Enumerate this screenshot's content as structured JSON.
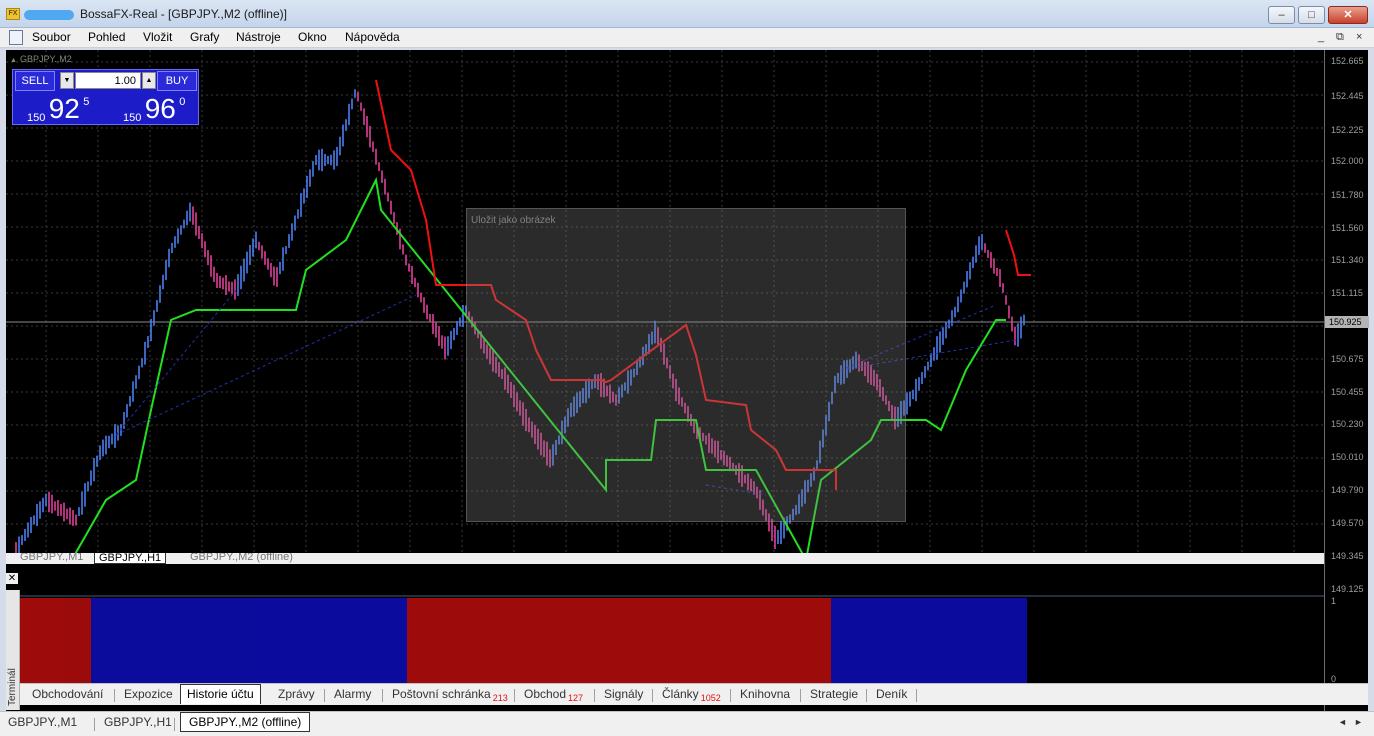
{
  "window": {
    "title": "BossaFX-Real - [GBPJPY.,M2 (offline)]",
    "minimize": "–",
    "maximize": "□",
    "close": "✕"
  },
  "menu": [
    "Soubor",
    "Pohled",
    "Vložit",
    "Grafy",
    "Nástroje",
    "Okno",
    "Nápověda"
  ],
  "mdi": [
    "_",
    "⧉",
    "×"
  ],
  "chart": {
    "label": "GBPJPY.,M2",
    "current_price": "150.925",
    "price_levels": [
      "152.665",
      "152.445",
      "152.225",
      "152.000",
      "151.780",
      "151.560",
      "151.340",
      "151.115",
      "150.675",
      "150.455",
      "150.230",
      "150.010",
      "149.790",
      "149.570",
      "149.345",
      "149.125"
    ],
    "indicator_scale_top": "1",
    "indicator_scale_bottom": "0",
    "colors": {
      "background": "#000000",
      "up_bar": "#4a7ff0",
      "down_bar": "#e0409a",
      "stop_up": "#20e020",
      "stop_down": "#f01010",
      "ind_bull": "#1010e0",
      "ind_bear": "#e01010"
    }
  },
  "trade_panel": {
    "sell_label": "SELL",
    "buy_label": "BUY",
    "lot": "1.00",
    "sell_prefix": "150",
    "sell_big": "92",
    "sell_sup": "5",
    "buy_prefix": "150",
    "buy_big": "96",
    "buy_sup": "0"
  },
  "dialog_ghost": {
    "title": "Uložit jako obrázek"
  },
  "chart_tabs_inner": [
    "GBPJPY.,M1",
    "GBPJPY.,H1",
    "GBPJPY.,M2 (offline)"
  ],
  "terminal": {
    "side_label": "Terminál",
    "tabs": [
      {
        "label": "Obchodování",
        "count": ""
      },
      {
        "label": "Expozice",
        "count": ""
      },
      {
        "label": "Historie účtu",
        "count": ""
      },
      {
        "label": "Zprávy",
        "count": ""
      },
      {
        "label": "Alarmy",
        "count": ""
      },
      {
        "label": "Poštovní schránka",
        "count": "213"
      },
      {
        "label": "Obchod",
        "count": "127"
      },
      {
        "label": "Signály",
        "count": ""
      },
      {
        "label": "Články",
        "count": "1052"
      },
      {
        "label": "Knihovna",
        "count": ""
      },
      {
        "label": "Strategie",
        "count": ""
      },
      {
        "label": "Deník",
        "count": ""
      }
    ],
    "active_tab": 2
  },
  "window_tabs": [
    "GBPJPY.,M1",
    "GBPJPY.,H1",
    "GBPJPY.,M2 (offline)"
  ],
  "window_tabs_active": 2,
  "scroll": [
    "◄",
    "►"
  ]
}
